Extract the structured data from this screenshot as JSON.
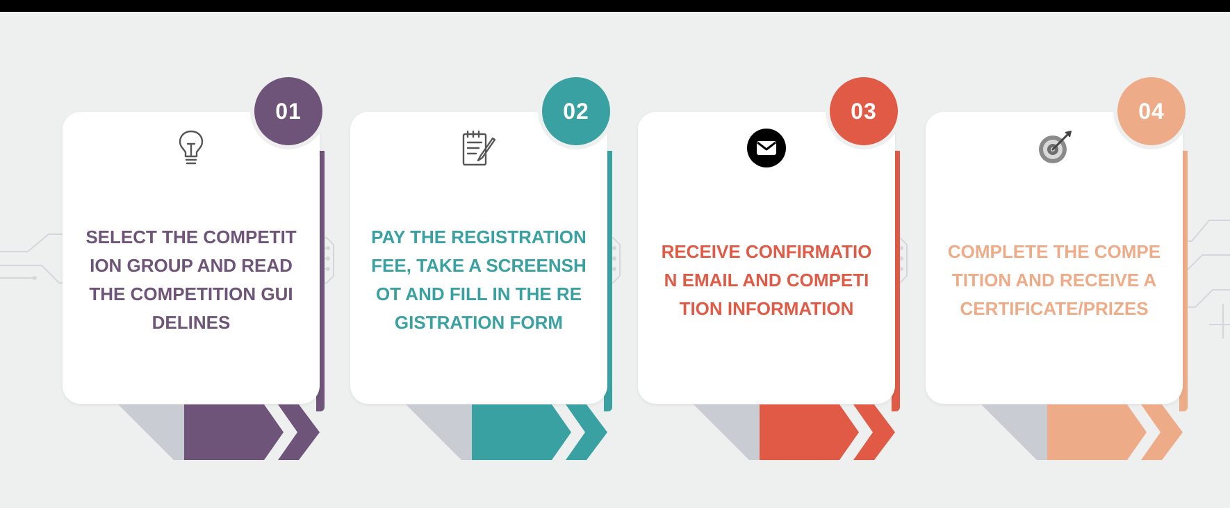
{
  "colors": {
    "background": "#eef0f0",
    "frame": "#000000",
    "card": "#ffffff",
    "shadow": "#c9cdd3",
    "circuit": "#d3d7db"
  },
  "steps": [
    {
      "number": "01",
      "icon": "lightbulb-icon",
      "text": "Select the competition group and read the competition guidelines",
      "color": "#6e5479"
    },
    {
      "number": "02",
      "icon": "notepad-pencil-icon",
      "text": "Pay the registration fee, take a screenshot and fill in the registration form",
      "color": "#3aa1a2"
    },
    {
      "number": "03",
      "icon": "envelope-icon",
      "text": "Receive confirmation email and competition information",
      "color": "#e05a45"
    },
    {
      "number": "04",
      "icon": "target-arrow-icon",
      "text": "Complete the competition and receive a certificate/prizes",
      "color": "#eeab87"
    }
  ]
}
